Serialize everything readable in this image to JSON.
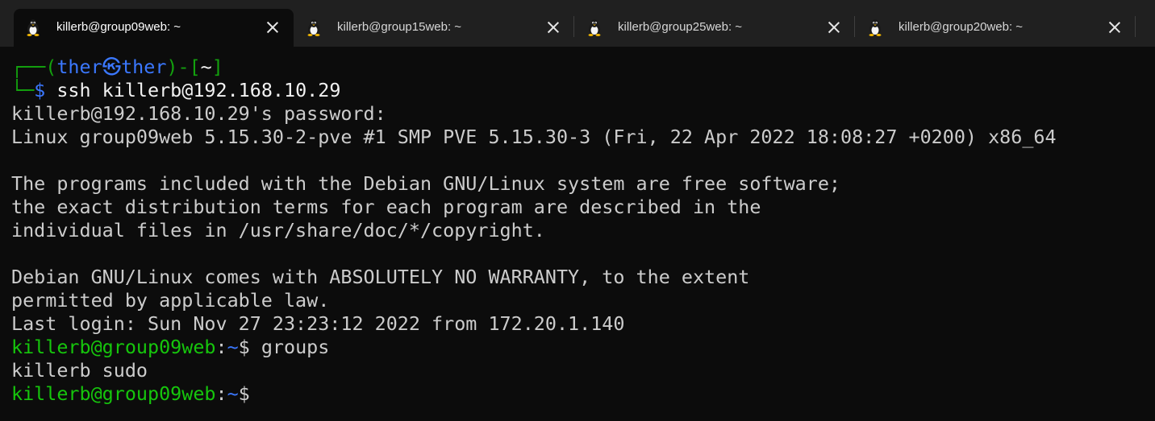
{
  "tabs": [
    {
      "title": "killerb@group09web: ~",
      "active": true
    },
    {
      "title": "killerb@group15web: ~",
      "active": false
    },
    {
      "title": "killerb@group25web: ~",
      "active": false
    },
    {
      "title": "killerb@group20web: ~",
      "active": false
    }
  ],
  "icons": {
    "tab": "tux-penguin-icon",
    "close": "close-icon",
    "skull": "skull-icon"
  },
  "prompt1": {
    "top_open": "┌──(",
    "user": "ther",
    "skull": "㉿",
    "host": "ther",
    "mid": ")-[",
    "path": "~",
    "close": "]",
    "bottom": "└─",
    "dollar": "$",
    "command": " ssh killerb@192.168.10.29"
  },
  "output": [
    "killerb@192.168.10.29's password:",
    "Linux group09web 5.15.30-2-pve #1 SMP PVE 5.15.30-3 (Fri, 22 Apr 2022 18:08:27 +0200) x86_64",
    "",
    "The programs included with the Debian GNU/Linux system are free software;",
    "the exact distribution terms for each program are described in the",
    "individual files in /usr/share/doc/*/copyright.",
    "",
    "Debian GNU/Linux comes with ABSOLUTELY NO WARRANTY, to the extent",
    "permitted by applicable law.",
    "Last login: Sun Nov 27 23:23:12 2022 from 172.20.1.140"
  ],
  "prompt2": {
    "user_host": "killerb@group09web",
    "colon": ":",
    "path": "~",
    "dollar": "$",
    "command": " groups"
  },
  "groups_output": "killerb sudo",
  "prompt3": {
    "user_host": "killerb@group09web",
    "colon": ":",
    "path": "~",
    "dollar": "$"
  },
  "colors": {
    "background": "#0c0c0c",
    "tabbar": "#202020",
    "green": "#13a10e",
    "blue": "#3b78ff",
    "text": "#cccccc"
  }
}
